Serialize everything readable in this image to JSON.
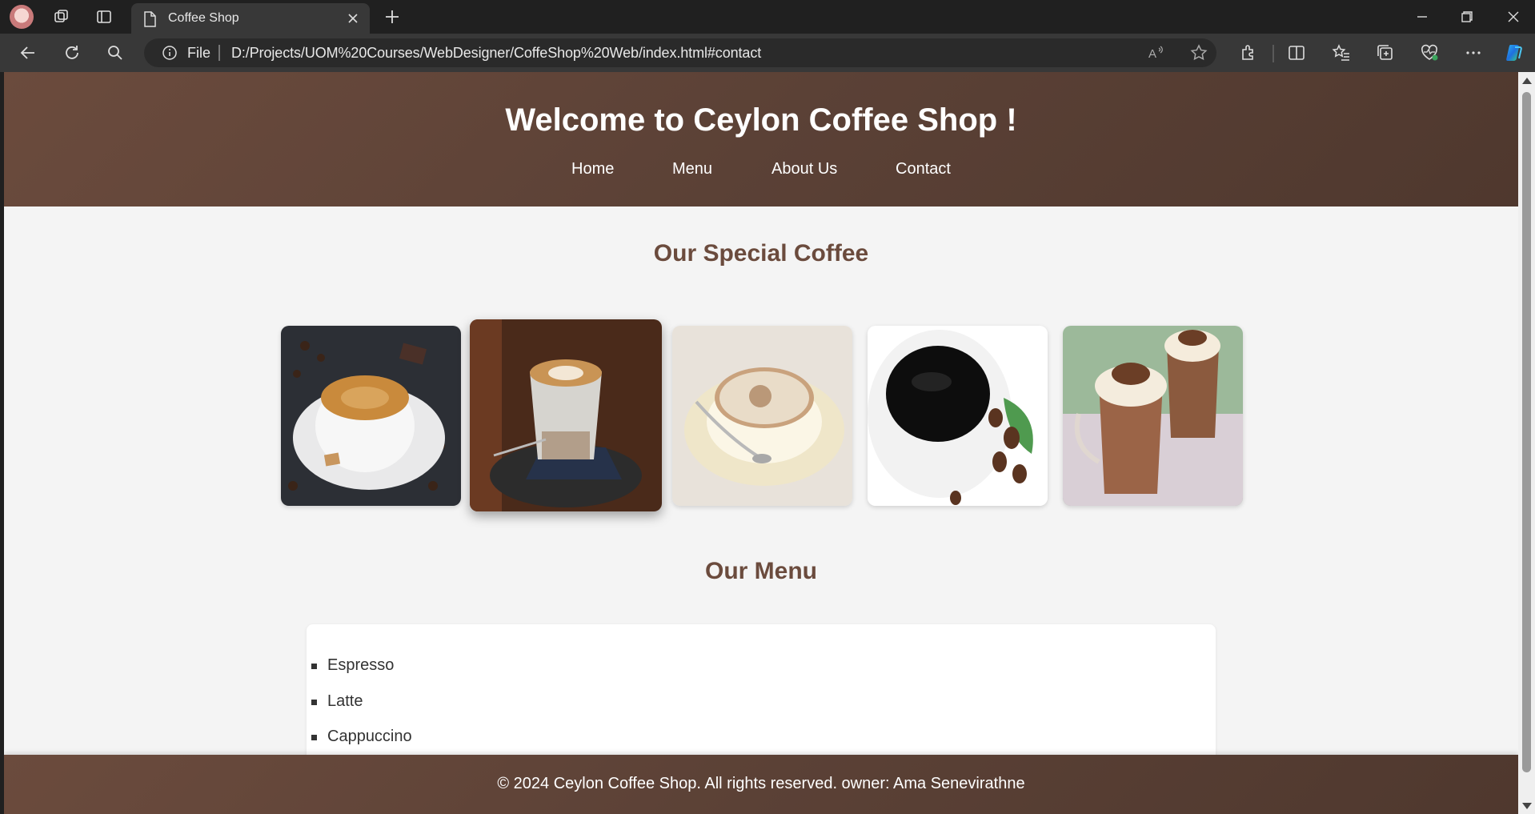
{
  "browser": {
    "tab_title": "Coffee Shop",
    "omnibox_scheme": "File",
    "url": "D:/Projects/UOM%20Courses/WebDesigner/CoffeShop%20Web/index.html#contact",
    "icons": [
      "profile-avatar",
      "workspaces-icon",
      "tab-actions-icon",
      "document-icon",
      "close-icon",
      "new-tab-icon",
      "minimize-icon",
      "restore-icon",
      "window-close-icon",
      "back-icon",
      "refresh-icon",
      "search-icon",
      "info-icon",
      "read-aloud-icon",
      "favorite-star-icon",
      "extensions-icon",
      "split-screen-icon",
      "favorites-icon",
      "collections-icon",
      "browser-essentials-icon",
      "more-icon",
      "copilot-icon"
    ]
  },
  "site": {
    "title": "Welcome to Ceylon Coffee Shop !",
    "nav": [
      "Home",
      "Menu",
      "About Us",
      "Contact"
    ],
    "special_heading": "Our Special Coffee",
    "gallery": [
      "espresso cup with coffee beans",
      "latte art glass",
      "cappuccino with spoon",
      "black coffee with beans and leaf",
      "iced mocha with cream"
    ],
    "menu_heading": "Our Menu",
    "menu_items": [
      "Espresso",
      "Latte",
      "Cappuccino"
    ],
    "footer": "© 2024 Ceylon Coffee Shop. All rights reserved. owner: Ama Senevirathne"
  },
  "colors": {
    "brand_brown": "#5b4136",
    "heading_brown": "#6b4b3d",
    "page_bg": "#f4f4f4"
  }
}
